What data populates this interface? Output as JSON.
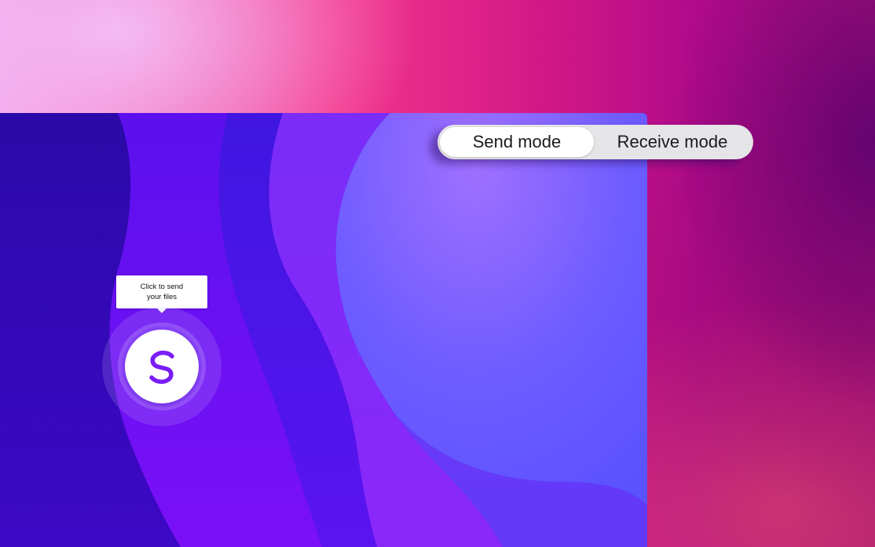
{
  "mode_toggle": {
    "options": [
      {
        "label": "Send mode",
        "selected": true
      },
      {
        "label": "Receive mode",
        "selected": false
      }
    ]
  },
  "send_button": {
    "tooltip": "Click to send your files",
    "icon": "app-logo-s-icon"
  },
  "colors": {
    "accent": "#7a1cf5",
    "background_pink": "#f4358b",
    "hero_violet": "#5a38ff"
  }
}
